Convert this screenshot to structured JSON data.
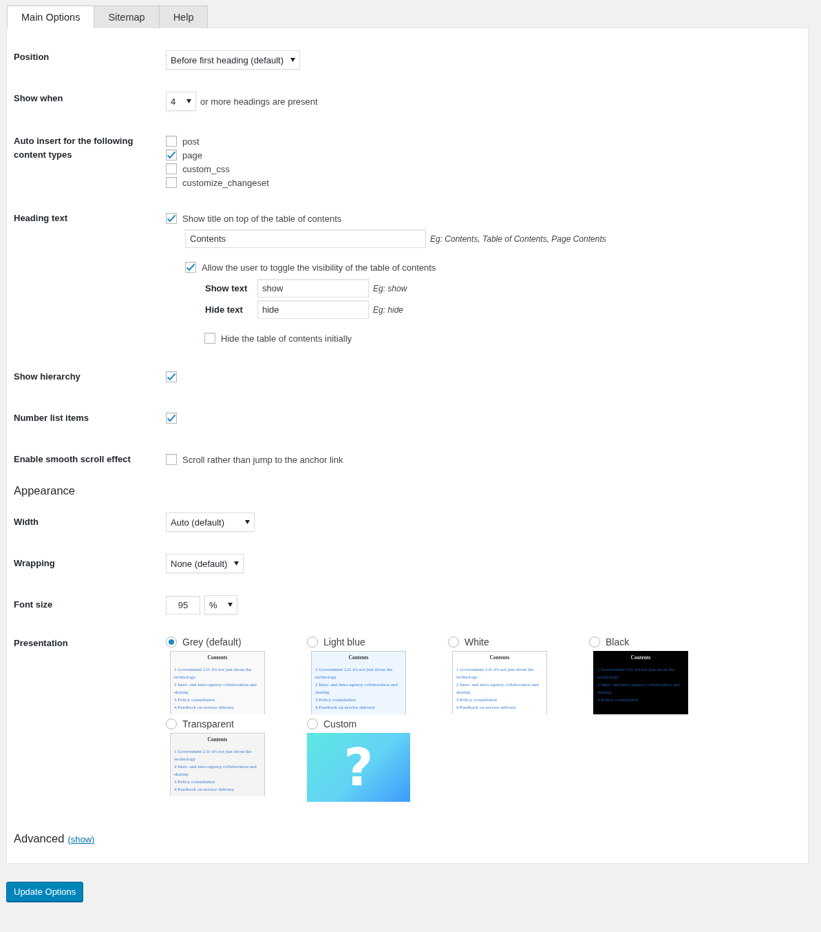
{
  "tabs": [
    {
      "label": "Main Options",
      "selected": true
    },
    {
      "label": "Sitemap",
      "selected": false
    },
    {
      "label": "Help",
      "selected": false
    }
  ],
  "position": {
    "label": "Position",
    "value": "Before first heading (default)"
  },
  "show_when": {
    "label": "Show when",
    "value": "4",
    "suffix": "or more headings are present"
  },
  "auto_insert": {
    "label": "Auto insert for the following content types",
    "options": [
      {
        "label": "post",
        "checked": false
      },
      {
        "label": "page",
        "checked": true
      },
      {
        "label": "custom_css",
        "checked": false
      },
      {
        "label": "customize_changeset",
        "checked": false
      }
    ]
  },
  "heading_text": {
    "label": "Heading text",
    "show_title": {
      "label": "Show title on top of the table of contents",
      "checked": true
    },
    "title_field": {
      "value": "Contents",
      "hint": "Eg: Contents, Table of Contents, Page Contents"
    },
    "toggle": {
      "label": "Allow the user to toggle the visibility of the table of contents",
      "checked": true
    },
    "show_text": {
      "label": "Show text",
      "value": "show",
      "hint": "Eg: show"
    },
    "hide_text": {
      "label": "Hide text",
      "value": "hide",
      "hint": "Eg: hide"
    },
    "hide_initially": {
      "label": "Hide the table of contents initially",
      "checked": false
    }
  },
  "show_hierarchy": {
    "label": "Show hierarchy",
    "checked": true
  },
  "number_list_items": {
    "label": "Number list items",
    "checked": true
  },
  "smooth_scroll": {
    "label": "Enable smooth scroll effect",
    "option": "Scroll rather than jump to the anchor link",
    "checked": false
  },
  "appearance": {
    "heading": "Appearance",
    "width": {
      "label": "Width",
      "value": "Auto (default)"
    },
    "wrapping": {
      "label": "Wrapping",
      "value": "None (default)"
    },
    "font_size": {
      "label": "Font size",
      "value": "95",
      "unit": "%"
    },
    "presentation": {
      "label": "Presentation",
      "themes": [
        {
          "kind": "grey",
          "label": "Grey (default)",
          "selected": true,
          "preview": {
            "title": "Contents",
            "items": [
              "1 Government 2.0: it's not just about the technology",
              "2 Inter- and intra-agency collaboration and sharing",
              "3 Policy consultation",
              "4 Feedback on service delivery"
            ]
          }
        },
        {
          "kind": "lightblue",
          "label": "Light blue",
          "selected": false,
          "preview": {
            "title": "Contents",
            "items": [
              "1 Government 2.0: it's not just about the technology",
              "2 Inter- and intra-agency collaboration and sharing",
              "3 Policy consultation",
              "4 Feedback on service delivery"
            ]
          }
        },
        {
          "kind": "white",
          "label": "White",
          "selected": false,
          "preview": {
            "title": "Contents",
            "items": [
              "1 Government 2.0: it's not just about the technology",
              "2 Inter- and intra-agency collaboration and sharing",
              "3 Policy consultation",
              "4 Feedback on service delivery"
            ]
          }
        },
        {
          "kind": "black",
          "label": "Black",
          "selected": false,
          "preview": {
            "title": "Contents",
            "items": [
              "1 Government 2.0: it's not just about the technology",
              "2 Inter- and intra-agency collaboration and sharing",
              "3 Policy consultation"
            ]
          }
        },
        {
          "kind": "transparent",
          "label": "Transparent",
          "selected": false,
          "preview": {
            "title": "Contents",
            "items": [
              "1 Government 2.0: it's not just about the technology",
              "2 Inter- and intra-agency collaboration and sharing",
              "3 Policy consultation",
              "4 Feedback on service delivery"
            ]
          }
        },
        {
          "kind": "custom",
          "label": "Custom",
          "selected": false,
          "preview": {
            "mark": "?"
          }
        }
      ]
    }
  },
  "advanced": {
    "heading": "Advanced",
    "link": "(show)"
  },
  "submit": "Update Options"
}
